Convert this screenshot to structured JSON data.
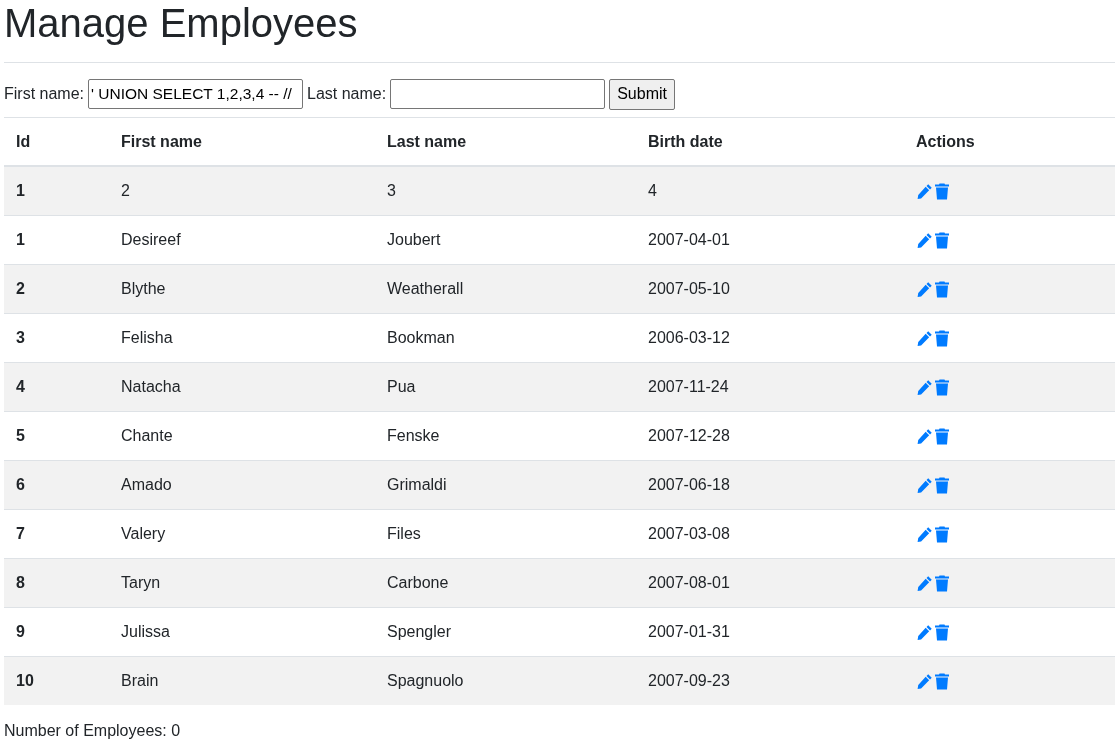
{
  "title": "Manage Employees",
  "form": {
    "first_name_label": "First name:",
    "first_name_value": "' UNION SELECT 1,2,3,4 -- //",
    "last_name_label": "Last name:",
    "submit": "Submit"
  },
  "table": {
    "columns": [
      "Id",
      "First name",
      "Last name",
      "Birth date",
      "Actions"
    ],
    "rows": [
      {
        "id": "1",
        "first": "2",
        "last": "3",
        "birth": "4"
      },
      {
        "id": "1",
        "first": "Desireef",
        "last": "Joubert",
        "birth": "2007-04-01"
      },
      {
        "id": "2",
        "first": "Blythe",
        "last": "Weatherall",
        "birth": "2007-05-10"
      },
      {
        "id": "3",
        "first": "Felisha",
        "last": "Bookman",
        "birth": "2006-03-12"
      },
      {
        "id": "4",
        "first": "Natacha",
        "last": "Pua",
        "birth": "2007-11-24"
      },
      {
        "id": "5",
        "first": "Chante",
        "last": "Fenske",
        "birth": "2007-12-28"
      },
      {
        "id": "6",
        "first": "Amado",
        "last": "Grimaldi",
        "birth": "2007-06-18"
      },
      {
        "id": "7",
        "first": "Valery",
        "last": "Files",
        "birth": "2007-03-08"
      },
      {
        "id": "8",
        "first": "Taryn",
        "last": "Carbone",
        "birth": "2007-08-01"
      },
      {
        "id": "9",
        "first": "Julissa",
        "last": "Spengler",
        "birth": "2007-01-31"
      },
      {
        "id": "10",
        "first": "Brain",
        "last": "Spagnuolo",
        "birth": "2007-09-23"
      }
    ]
  },
  "footer": "Number of Employees: 0"
}
